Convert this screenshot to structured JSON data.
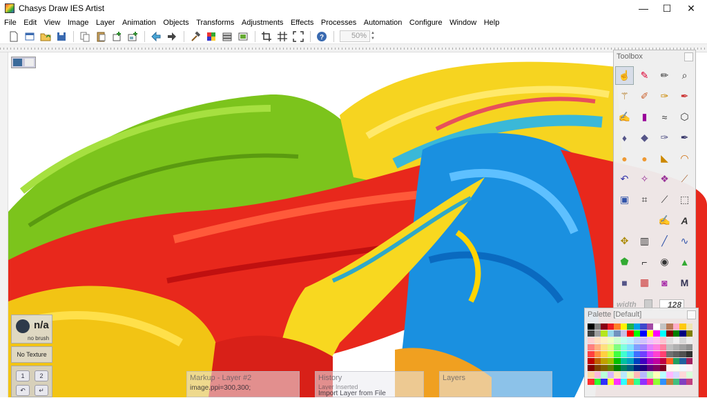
{
  "window": {
    "title": "Chasys Draw IES Artist",
    "controls": {
      "minimize": "—",
      "maximize": "☐",
      "close": "✕"
    }
  },
  "menu": [
    "File",
    "Edit",
    "View",
    "Image",
    "Layer",
    "Animation",
    "Objects",
    "Transforms",
    "Adjustments",
    "Effects",
    "Processes",
    "Automation",
    "Configure",
    "Window",
    "Help"
  ],
  "toolbar": {
    "zoom": "50%"
  },
  "toolbox": {
    "title": "Toolbox",
    "width_label": "width",
    "width_value": "128"
  },
  "palette": {
    "title": "Palette [Default]",
    "colors": [
      "#000000",
      "#7f7f7f",
      "#880015",
      "#ed1c24",
      "#ff7f27",
      "#fff200",
      "#22b14c",
      "#00a2e8",
      "#3f48cc",
      "#a349a4",
      "#ffffff",
      "#c3c3c3",
      "#b97a57",
      "#ffaec9",
      "#ffc90e",
      "#efe4b0",
      "#404040",
      "#9e9e9e",
      "#b5e61d",
      "#99d9ea",
      "#7092be",
      "#c8bfe7",
      "#ff0000",
      "#00ff00",
      "#0000ff",
      "#ffff00",
      "#ff00ff",
      "#00ffff",
      "#800000",
      "#008000",
      "#000080",
      "#808000",
      "#ffd0d0",
      "#ffe0c0",
      "#fff0c0",
      "#f0ffc0",
      "#d0ffd0",
      "#c0fff0",
      "#c0f0ff",
      "#c0d0ff",
      "#d0c0ff",
      "#f0c0ff",
      "#ffc0f0",
      "#ffc0d0",
      "#e0e0e0",
      "#f0f0f0",
      "#d8d8d8",
      "#ececec",
      "#ff8080",
      "#ffb080",
      "#ffe080",
      "#e0ff80",
      "#80ff80",
      "#80ffe0",
      "#80e0ff",
      "#80a0ff",
      "#a080ff",
      "#e080ff",
      "#ff80e0",
      "#ff80a0",
      "#c0c0c0",
      "#b0b0b0",
      "#a0a0a0",
      "#909090",
      "#ff4040",
      "#ff9040",
      "#ffd040",
      "#d0ff40",
      "#40ff40",
      "#40ffd0",
      "#40d0ff",
      "#4070ff",
      "#7040ff",
      "#d040ff",
      "#ff40d0",
      "#ff4070",
      "#707070",
      "#606060",
      "#505050",
      "#303030",
      "#c00000",
      "#c06000",
      "#c0a000",
      "#a0c000",
      "#00c000",
      "#00c0a0",
      "#00a0c0",
      "#0040c0",
      "#4000c0",
      "#a000c0",
      "#c000a0",
      "#c00040",
      "#ff6020",
      "#20a060",
      "#2060a0",
      "#a02060",
      "#800000",
      "#804000",
      "#806000",
      "#608000",
      "#008000",
      "#008060",
      "#006080",
      "#002080",
      "#200080",
      "#600080",
      "#800060",
      "#800020",
      "#fff8f0",
      "#f8fff0",
      "#f0f8ff",
      "#fff0f8",
      "#ffd8a0",
      "#ffb8d8",
      "#b8ffd8",
      "#d8b8ff",
      "#ffe8b8",
      "#b8e8ff",
      "#e8ffb8",
      "#ffb8b8",
      "#b8b8ff",
      "#b8ffb8",
      "#ffffb8",
      "#b8ffff",
      "#ffb8ff",
      "#d8d8ff",
      "#ffd8d8",
      "#d8ffd8",
      "#ff3030",
      "#30ff30",
      "#3030ff",
      "#ffff30",
      "#ff30ff",
      "#30ffff",
      "#ff9030",
      "#30ff90",
      "#9030ff",
      "#ff3090",
      "#90ff30",
      "#3090ff",
      "#c08040",
      "#40c080",
      "#8040c0",
      "#c04080"
    ]
  },
  "brush": {
    "name": "n/a",
    "sub": "no brush",
    "texture": "No Texture"
  },
  "keypad": [
    "1",
    "2",
    "↶",
    "↵"
  ],
  "panels": {
    "markup": {
      "title": "Markup - Layer #2",
      "line": "image.ppi=300,300;"
    },
    "history": {
      "title": "History",
      "lines": [
        "Layer Inserted",
        "Import Layer from File"
      ]
    },
    "layers": {
      "title": "Layers"
    }
  }
}
